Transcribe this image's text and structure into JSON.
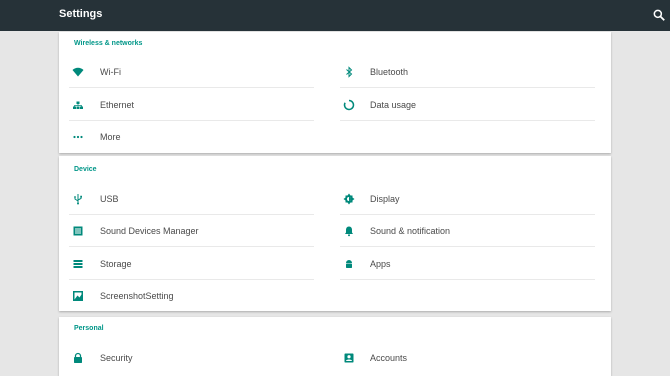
{
  "app": {
    "title": "Settings",
    "search_icon": "search-icon"
  },
  "sections": [
    {
      "title": "Wireless & networks",
      "items": [
        {
          "label": "Wi-Fi",
          "icon": "wifi-icon"
        },
        {
          "label": "Bluetooth",
          "icon": "bluetooth-icon"
        },
        {
          "label": "Ethernet",
          "icon": "ethernet-icon"
        },
        {
          "label": "Data usage",
          "icon": "data-usage-icon"
        },
        {
          "label": "More",
          "icon": "more-dots-icon"
        }
      ]
    },
    {
      "title": "Device",
      "items": [
        {
          "label": "USB",
          "icon": "usb-icon"
        },
        {
          "label": "Display",
          "icon": "display-icon"
        },
        {
          "label": "Sound Devices Manager",
          "icon": "sound-devices-icon"
        },
        {
          "label": "Sound & notification",
          "icon": "bell-icon"
        },
        {
          "label": "Storage",
          "icon": "storage-icon"
        },
        {
          "label": "Apps",
          "icon": "android-icon"
        },
        {
          "label": "ScreenshotSetting",
          "icon": "screenshot-icon"
        }
      ]
    },
    {
      "title": "Personal",
      "items": [
        {
          "label": "Security",
          "icon": "lock-icon"
        },
        {
          "label": "Accounts",
          "icon": "account-icon"
        }
      ]
    }
  ],
  "colors": {
    "appbar": "#263238",
    "accent": "#009688",
    "icon": "#00897b"
  }
}
